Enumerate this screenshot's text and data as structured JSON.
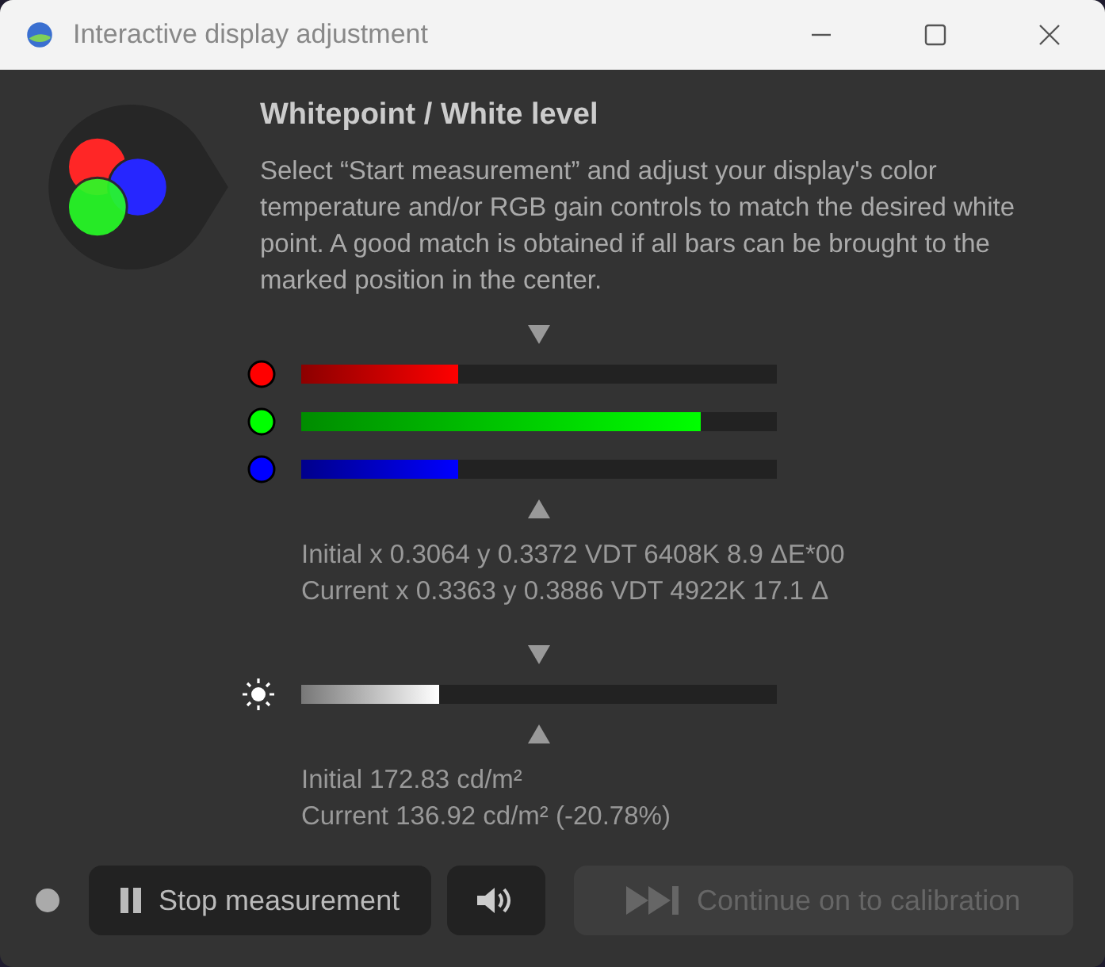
{
  "window": {
    "title": "Interactive display adjustment"
  },
  "heading": "Whitepoint / White level",
  "description": "Select “Start measurement” and adjust your display's color temperature and/or RGB gain controls to match the desired white point. A good match is obtained if all bars can be brought to the marked position in the center.",
  "channels": [
    {
      "color": "#ff0000",
      "level": 0.33
    },
    {
      "color": "#00ff00",
      "level": 0.84
    },
    {
      "color": "#0000ff",
      "level": 0.33
    }
  ],
  "chromaticity": [
    "Initial x 0.3064 y 0.3372 VDT 6408K 8.9 ΔE*00",
    "Current x 0.3363 y 0.3886 VDT 4922K 17.1 Δ"
  ],
  "brightness": {
    "level": 0.29
  },
  "luminance": [
    "Initial 172.83 cd/m²",
    "Current 136.92 cd/m² (-20.78%)"
  ],
  "buttons": [
    {
      "kind": "pause",
      "label": "Stop measurement",
      "disabled": false
    },
    {
      "kind": "sound",
      "disabled": false
    },
    {
      "kind": "skip",
      "label": "Continue on to calibration",
      "disabled": true
    }
  ]
}
